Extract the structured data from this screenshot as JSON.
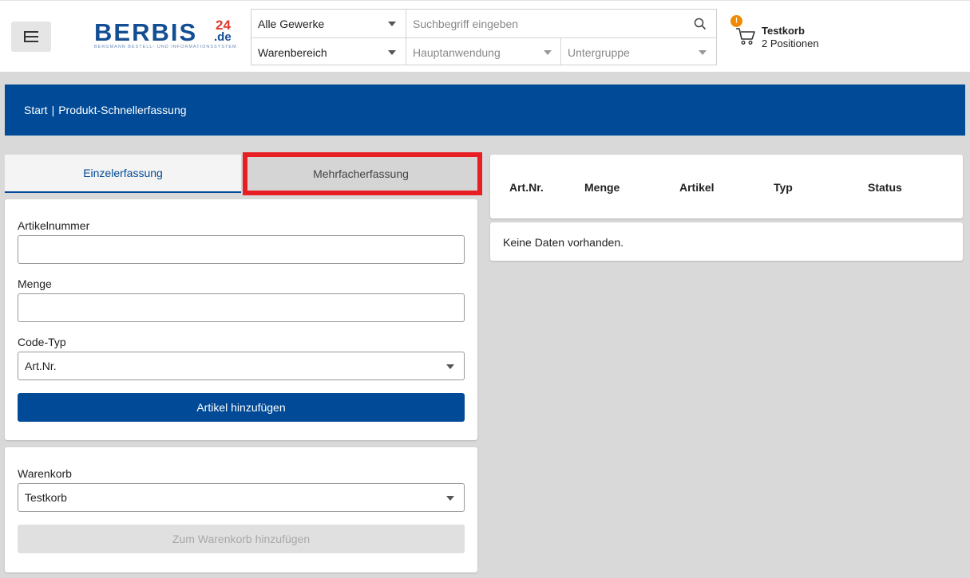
{
  "header": {
    "logo": {
      "brand": "BERBIS",
      "number": "24",
      "tld": ".de",
      "tagline": "BERGMANN BESTELL- UND INFORMATIONSSYSTEM"
    },
    "search": {
      "trade_select": "Alle Gewerke",
      "search_placeholder": "Suchbegriff eingeben",
      "product_area_select": "Warenbereich",
      "main_application_placeholder": "Hauptanwendung",
      "subgroup_placeholder": "Untergruppe"
    },
    "cart": {
      "badge": "!",
      "name": "Testkorb",
      "positions": "2 Positionen"
    }
  },
  "breadcrumb": {
    "start": "Start",
    "separator": "|",
    "current": "Produkt-Schnellerfassung"
  },
  "tabs": {
    "single": "Einzelerfassung",
    "multiple": "Mehrfacherfassung"
  },
  "form": {
    "article_number_label": "Artikelnummer",
    "quantity_label": "Menge",
    "code_type_label": "Code-Typ",
    "code_type_value": "Art.Nr.",
    "add_article_button": "Artikel hinzufügen"
  },
  "cart_form": {
    "label": "Warenkorb",
    "value": "Testkorb",
    "add_to_cart_button": "Zum Warenkorb hinzufügen"
  },
  "table": {
    "columns": [
      "Art.Nr.",
      "Menge",
      "Artikel",
      "Typ",
      "Status"
    ],
    "empty_message": "Keine Daten vorhanden."
  },
  "colors": {
    "primary": "#004a97",
    "highlight": "#e81e25",
    "badge": "#f08a00",
    "logo_red": "#e23a2b"
  }
}
